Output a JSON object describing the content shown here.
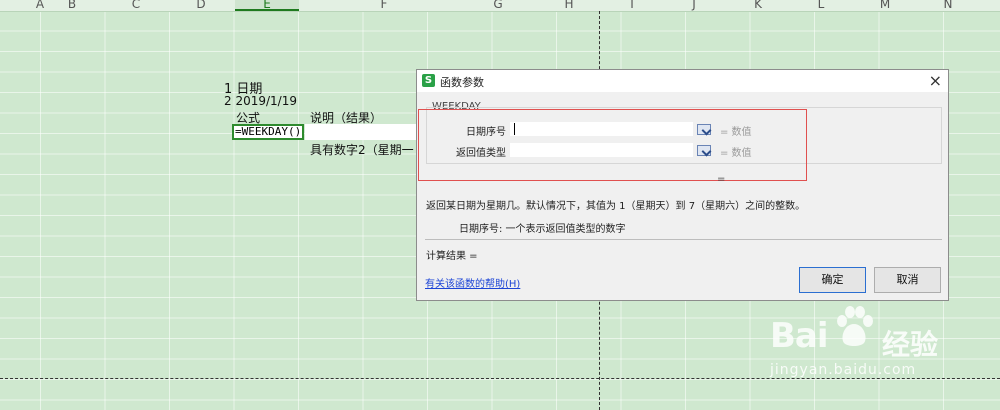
{
  "spreadsheet": {
    "columns": [
      "A",
      "B",
      "C",
      "D",
      "E",
      "F",
      "G",
      "H",
      "I",
      "J",
      "K",
      "L",
      "M",
      "N"
    ],
    "active_column": "E",
    "cells": {
      "r1": "1 日期",
      "r2": "2  2019/1/19",
      "formula_header": "公式",
      "desc_header": "说明（结果）",
      "formula": "=WEEKDAY()",
      "overflow_text": "具有数字2（星期一"
    }
  },
  "dialog": {
    "title": "函数参数",
    "app_logo": "S",
    "function_name": "WEEKDAY",
    "params": [
      {
        "label": "日期序号",
        "value": "",
        "result": "= 数值"
      },
      {
        "label": "返回值类型",
        "value": "",
        "result": "= 数值"
      }
    ],
    "equals": "=",
    "description": "返回某日期为星期几。默认情况下，其值为 1（星期天）到 7（星期六）之间的整数。",
    "param_description": "日期序号:  一个表示返回值类型的数字",
    "result_label": "计算结果  =",
    "help_link": "有关该函数的帮助(H)",
    "ok_label": "确定",
    "cancel_label": "取消",
    "close_icon": "×"
  },
  "watermark": {
    "brand": "Bai",
    "product": "经验",
    "url": "jingyan.baidu.com"
  },
  "colors": {
    "sheet_bg": "#cfe8cf",
    "active_cell_border": "#2e8b2e",
    "highlight_box": "#e0504f",
    "help_link": "#1d45d6"
  }
}
